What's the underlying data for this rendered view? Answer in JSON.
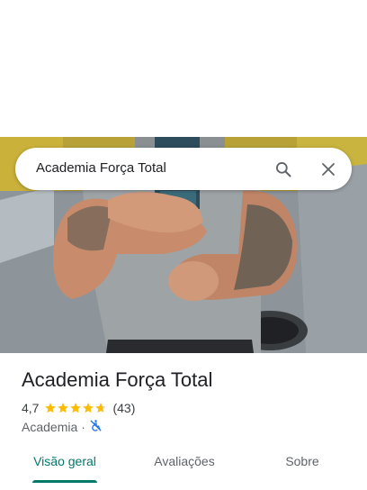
{
  "search": {
    "query": "Academia Força Total"
  },
  "place": {
    "name": "Academia Força Total",
    "rating": "4,7",
    "rating_value": 4.7,
    "review_count": "(43)",
    "category": "Academia",
    "separator": "·",
    "accessibility_icon": "not-accessible-icon"
  },
  "tabs": [
    {
      "label": "Visão geral",
      "active": true
    },
    {
      "label": "Avaliações",
      "active": false
    },
    {
      "label": "Sobre",
      "active": false
    }
  ],
  "colors": {
    "accent": "#00796b",
    "star": "#fbbc04",
    "accessibility_icon": "#1a73e8"
  }
}
